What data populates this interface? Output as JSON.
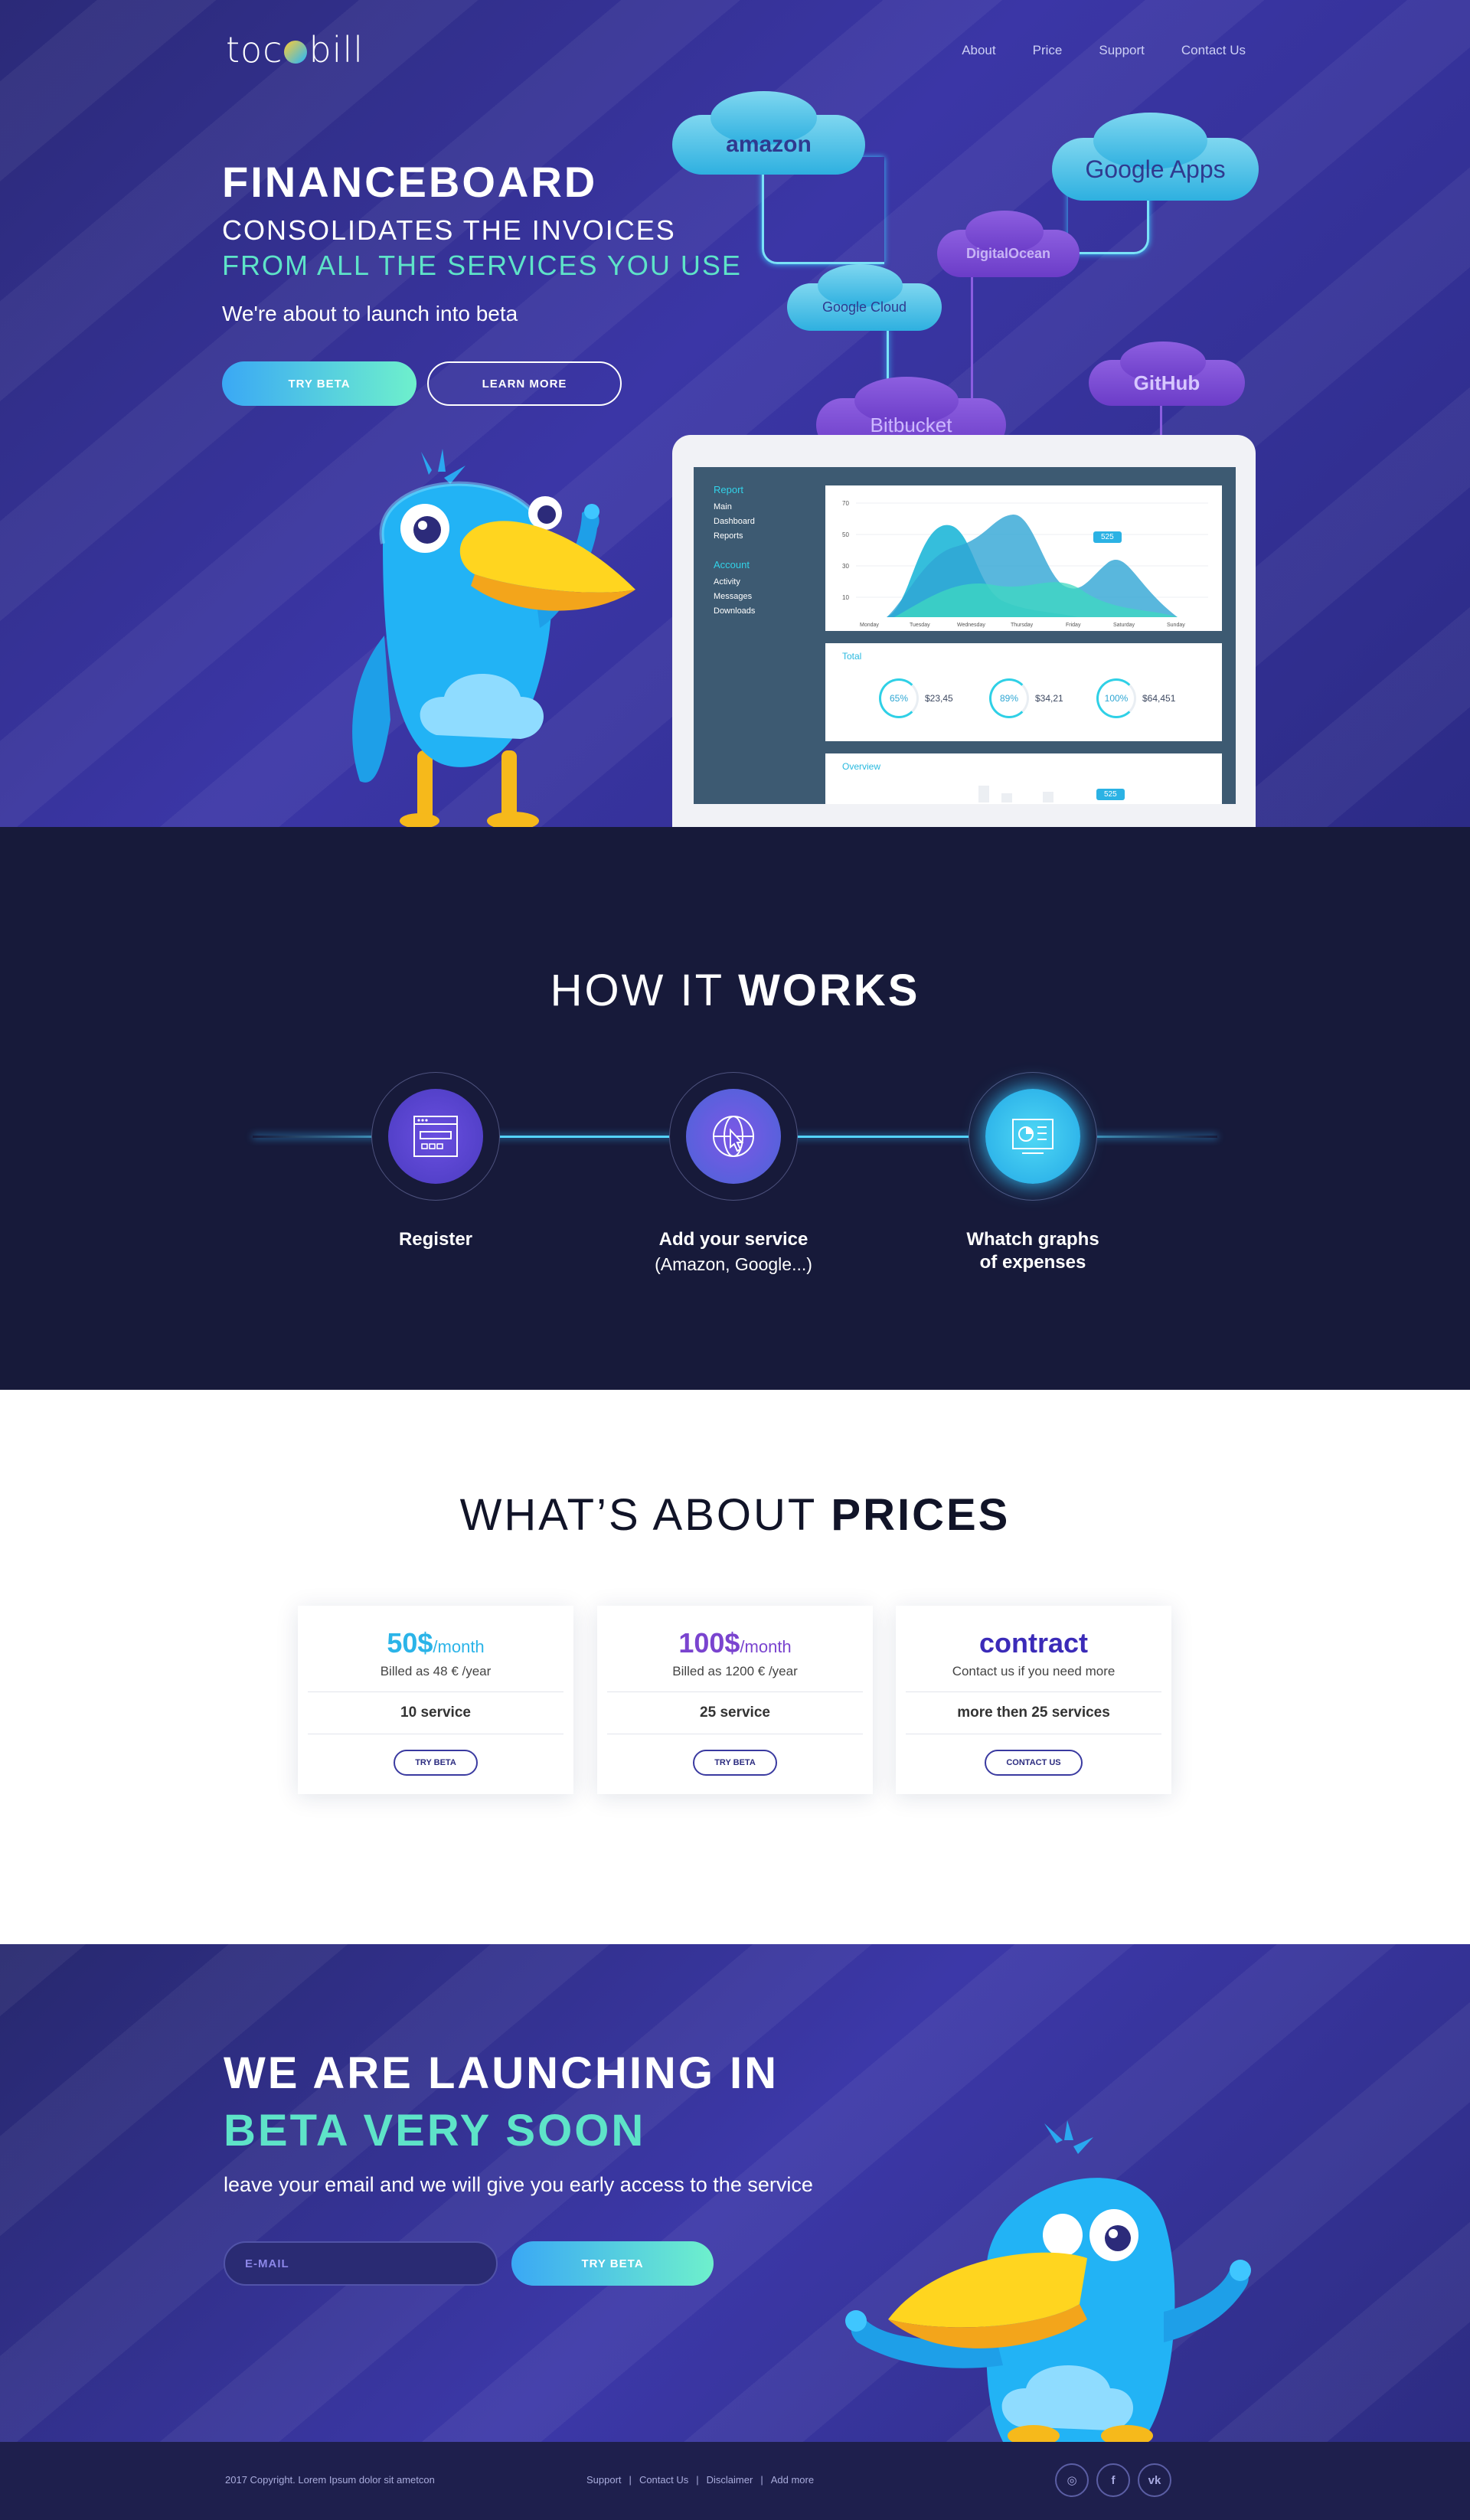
{
  "nav": {
    "logo_left": "toc",
    "logo_right": "bill",
    "links": [
      "About",
      "Price",
      "Support",
      "Contact Us"
    ]
  },
  "hero": {
    "title": "FINANCEBOARD",
    "subtitle_1": "CONSOLIDATES THE INVOICES",
    "subtitle_2": "FROM ALL THE SERVICES YOU USE",
    "tagline": "We're about to launch into beta",
    "try_beta": "TRY BETA",
    "learn_more": "LEARN MORE"
  },
  "clouds": {
    "amazon": "amazon",
    "google_apps": "Google Apps",
    "digitalocean": "DigitalOcean",
    "google_cloud": "Google Cloud",
    "github": "GitHub",
    "bitbucket": "Bitbucket"
  },
  "dashboard": {
    "menu_report": "Report",
    "report_items": [
      "Main",
      "Dashboard",
      "Reports"
    ],
    "menu_account": "Account",
    "account_items": [
      "Activity",
      "Messages",
      "Downloads"
    ],
    "chart_y_ticks": [
      "70",
      "50",
      "30",
      "10"
    ],
    "chart_x_ticks": [
      "Monday",
      "Tuesday",
      "Wednesday",
      "Thursday",
      "Friday",
      "Saturday",
      "Sunday"
    ],
    "chart_badge": "525",
    "total_label": "Total",
    "stats": [
      {
        "percent": "65%",
        "value": "$23,45"
      },
      {
        "percent": "89%",
        "value": "$34,21"
      },
      {
        "percent": "100%",
        "value": "$64,451"
      }
    ],
    "overview_label": "Overview",
    "overview_badge": "525"
  },
  "how": {
    "title_light": "HOW IT ",
    "title_bold": "WORKS",
    "steps": [
      {
        "title": "Register",
        "sub": ""
      },
      {
        "title": "Add your service",
        "sub": "(Amazon, Google...)"
      },
      {
        "title": "Whatch graphs",
        "title2": "of expenses"
      }
    ]
  },
  "prices": {
    "title_light": "WHAT’S ABOUT ",
    "title_bold": "PRICES",
    "plans": [
      {
        "price": "50$",
        "per": "/month",
        "billed": "Billed as 48 € /year",
        "services": "10 service",
        "button": "TRY BETA",
        "color": "#2bb4e8"
      },
      {
        "price": "100$",
        "per": "/month",
        "billed": "Billed as 1200 € /year",
        "services": "25 service",
        "button": "TRY BETA",
        "color": "#7a44cf"
      },
      {
        "price": "contract",
        "per": "",
        "billed": "Contact us if you need more",
        "services": "more then 25 services",
        "button": "CONTACT US",
        "color": "#3b2bb8"
      }
    ]
  },
  "launch": {
    "title_1": "WE ARE LAUNCHING IN",
    "title_2": "BETA VERY SOON",
    "text": "leave your email and we will give you early access to the service",
    "email_placeholder": "E-MAIL",
    "button": "TRY BETA"
  },
  "footer": {
    "copyright": "2017 Copyright. Lorem Ipsum dolor sit ametcon",
    "links": [
      "Support",
      "Contact Us",
      "Disclaimer",
      "Add more"
    ],
    "separator": "|",
    "social": [
      "instagram-icon",
      "facebook-icon",
      "vk-icon"
    ],
    "social_labels": [
      "◎",
      "f",
      "vk"
    ]
  }
}
